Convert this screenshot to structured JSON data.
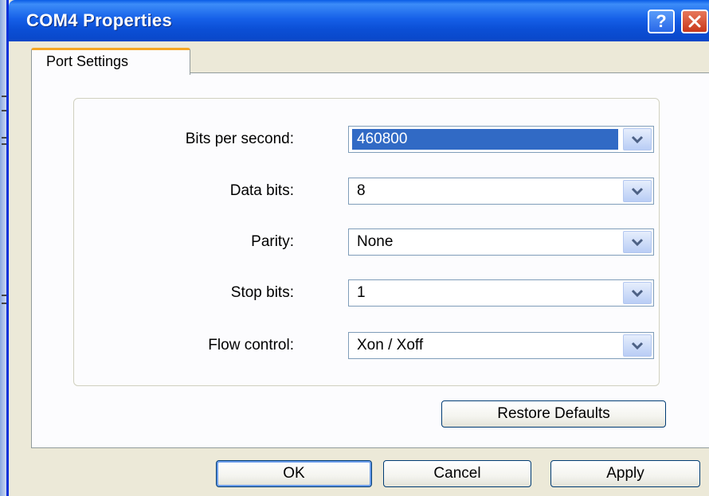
{
  "window": {
    "title": "COM4 Properties",
    "help_glyph": "?",
    "close_glyph": "✕"
  },
  "tabs": [
    {
      "label": "Port Settings",
      "active": true
    }
  ],
  "fields": [
    {
      "label": "Bits per second:",
      "value": "460800",
      "selected": true
    },
    {
      "label": "Data bits:",
      "value": "8"
    },
    {
      "label": "Parity:",
      "value": "None"
    },
    {
      "label": "Stop bits:",
      "value": "1"
    },
    {
      "label": "Flow control:",
      "value": "Xon / Xoff"
    }
  ],
  "buttons": {
    "restore_defaults": "Restore Defaults",
    "ok": "OK",
    "cancel": "Cancel",
    "apply": "Apply"
  },
  "colors": {
    "titlebar": "#0b4fd6",
    "selection": "#316ac5",
    "tab_accent": "#f5a623"
  }
}
